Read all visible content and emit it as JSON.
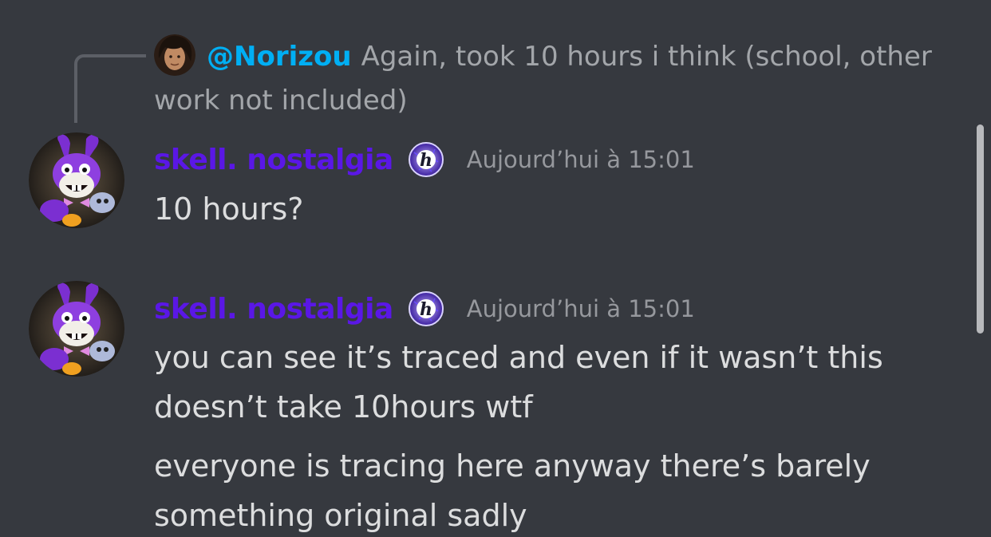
{
  "reply": {
    "author": "@Norizou",
    "text": "Again, took 10 hours i think (school, other work not included)"
  },
  "messages": [
    {
      "username": "skell. nostalgia",
      "timestamp": "Aujourd’hui à 15:01",
      "lines": [
        "10 hours?"
      ]
    },
    {
      "username": "skell. nostalgia",
      "timestamp": "Aujourd’hui à 15:01",
      "lines": [
        "you can see it’s traced and even if it wasn’t this doesn’t take 10hours wtf",
        "everyone is tracing here anyway there’s barely something original sadly"
      ]
    }
  ],
  "role_icon": {
    "glyph": "h",
    "name": "h-badge-icon"
  },
  "colors": {
    "background": "#36393f",
    "username": "#5a17e6",
    "mention": "#00aff4",
    "timestamp": "#96989d",
    "reply_text": "#a3a6aa",
    "message_text": "#dcddde"
  }
}
